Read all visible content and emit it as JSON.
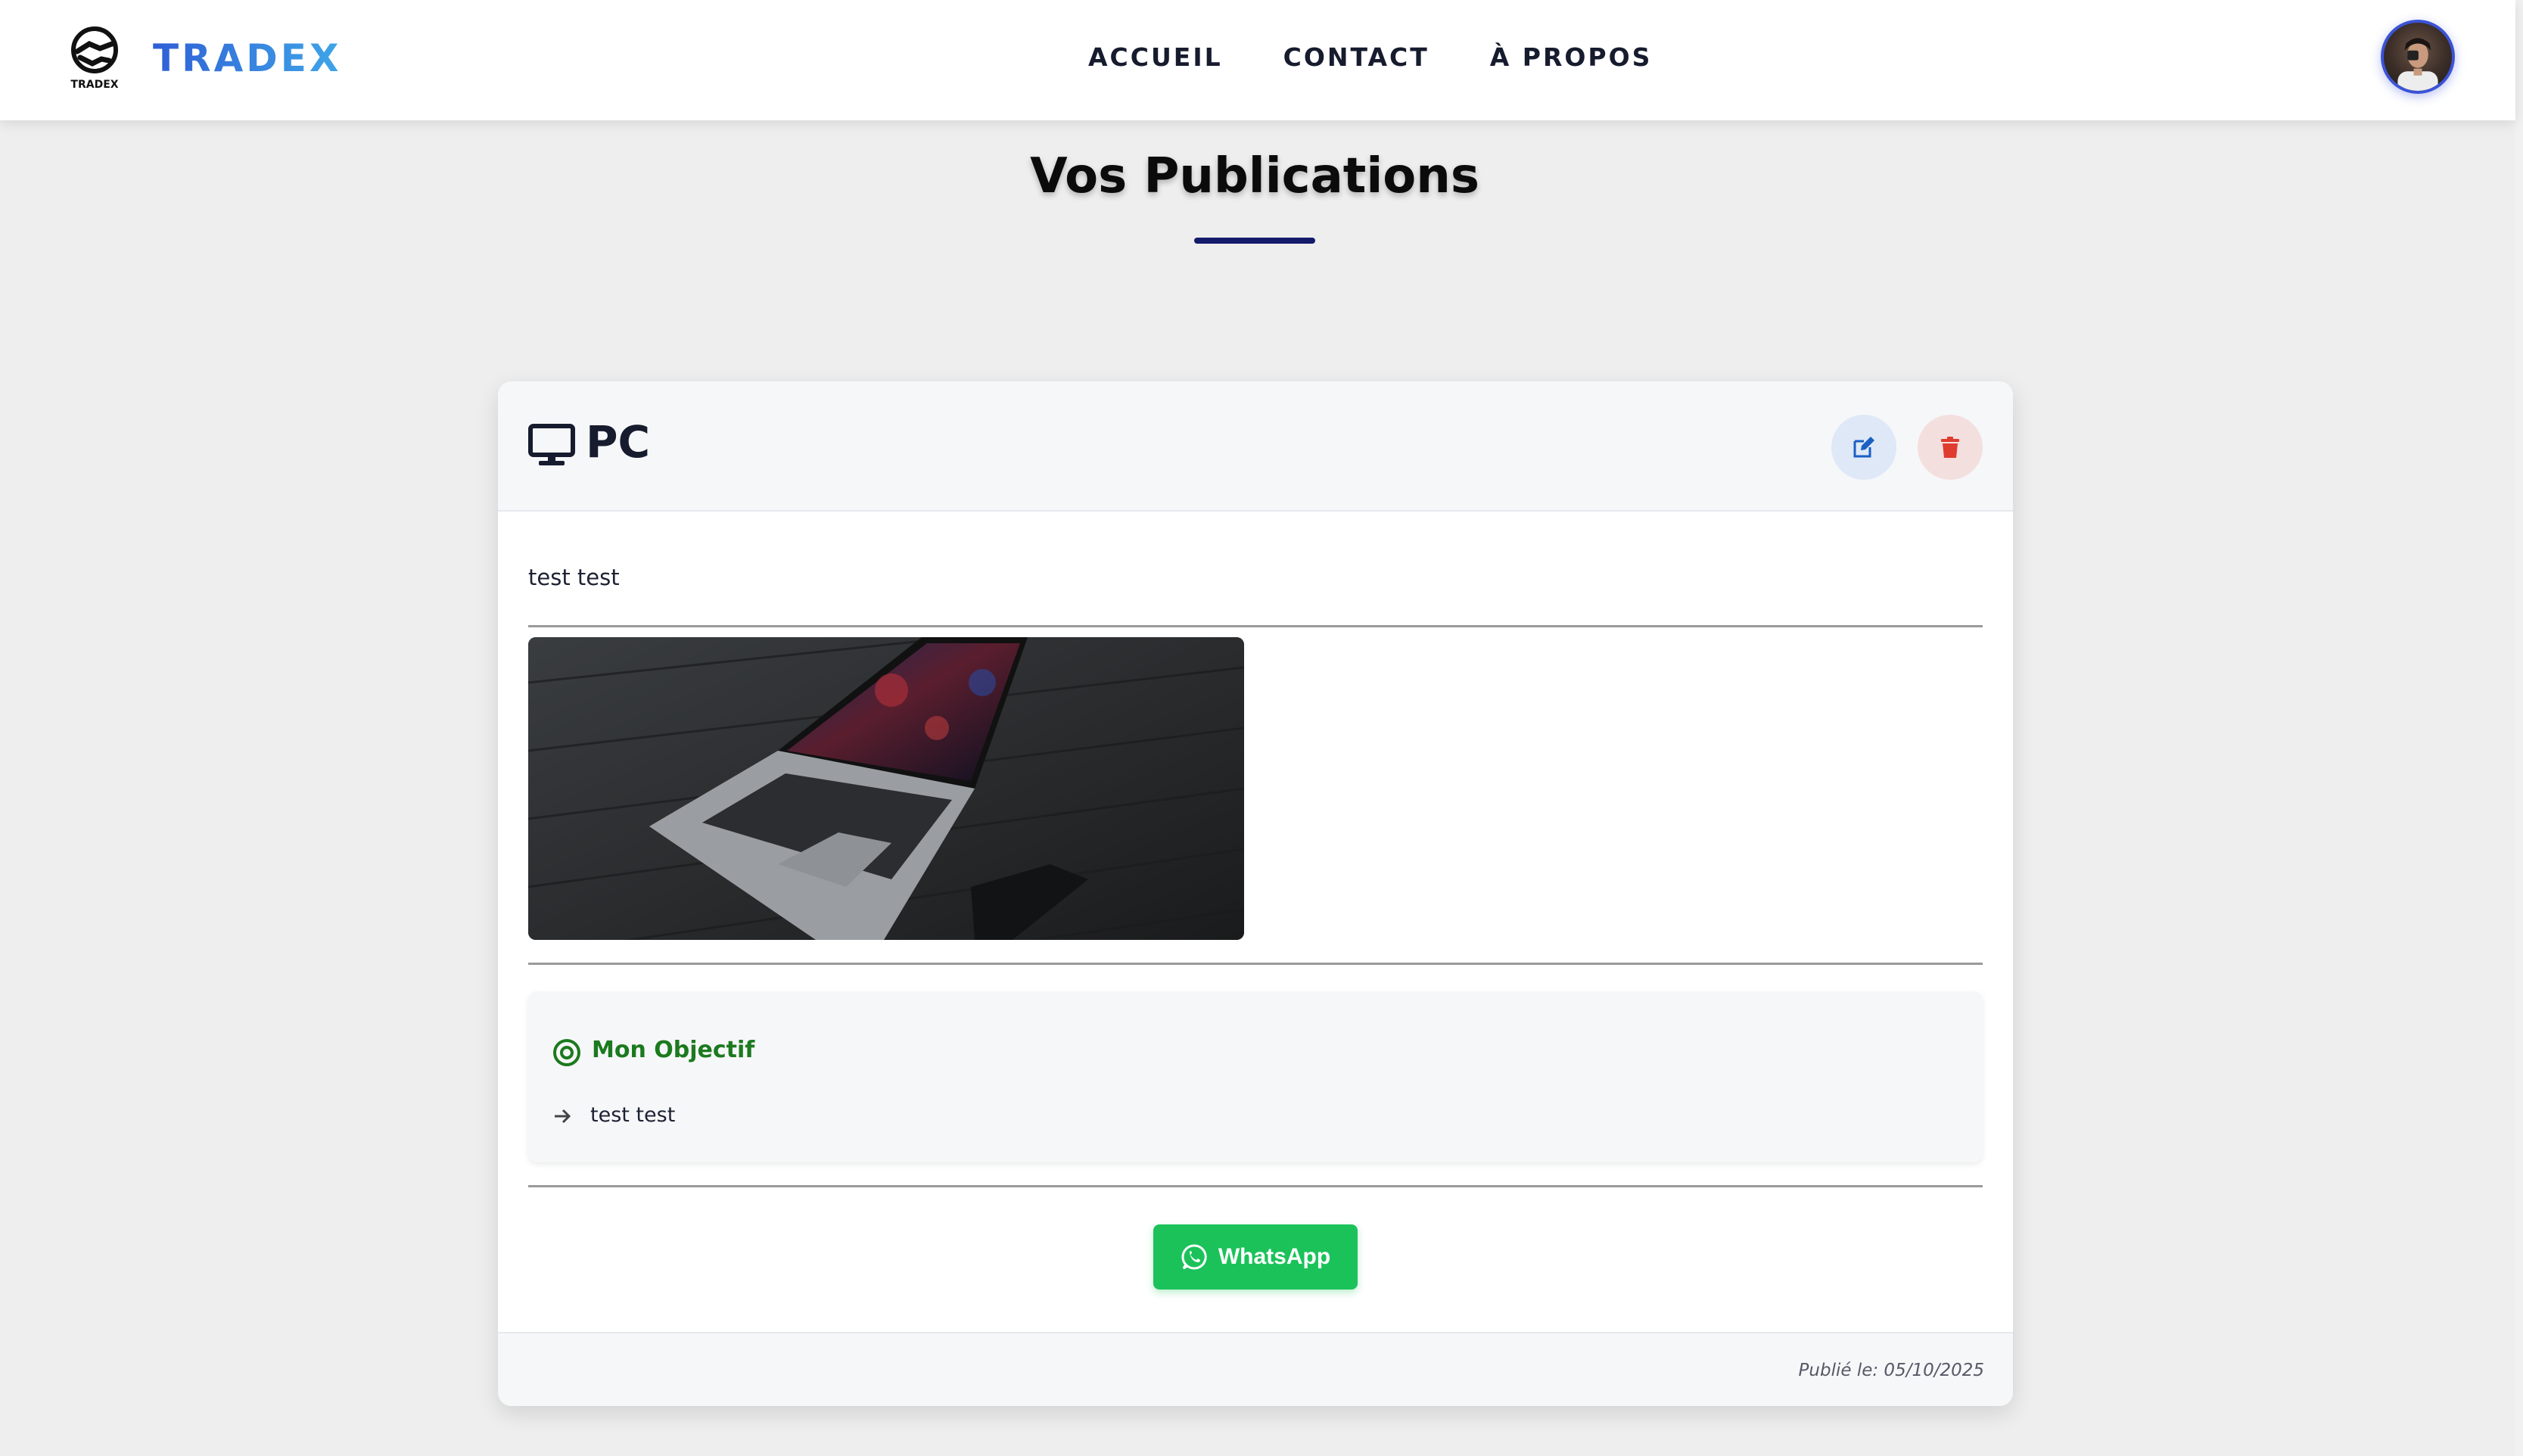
{
  "brand": {
    "name": "TRADEX",
    "logo_text": "TRADEX"
  },
  "nav": {
    "links": [
      "ACCUEIL",
      "CONTACT",
      "À PROPOS"
    ]
  },
  "page": {
    "title": "Vos Publications"
  },
  "card": {
    "title": "PC",
    "description": "test test",
    "objective": {
      "title": "Mon Objectif",
      "text": "test test"
    },
    "whatsapp_label": "WhatsApp",
    "published": "Publié le: 05/10/2025"
  },
  "icons": {
    "logo": "handshake-logo-icon",
    "title": "desktop-icon",
    "edit": "edit-icon",
    "delete": "trash-icon",
    "objective": "target-icon",
    "bullet": "arrow-right-icon",
    "whatsapp": "whatsapp-icon"
  },
  "colors": {
    "brand_gradient_start": "#2f5fd6",
    "brand_gradient_end": "#3fa6e8",
    "title_underline": "#141b6b",
    "edit": "#1a5fc4",
    "delete": "#e03b2f",
    "objective": "#1c7a1e",
    "whatsapp": "#1bc25a"
  }
}
